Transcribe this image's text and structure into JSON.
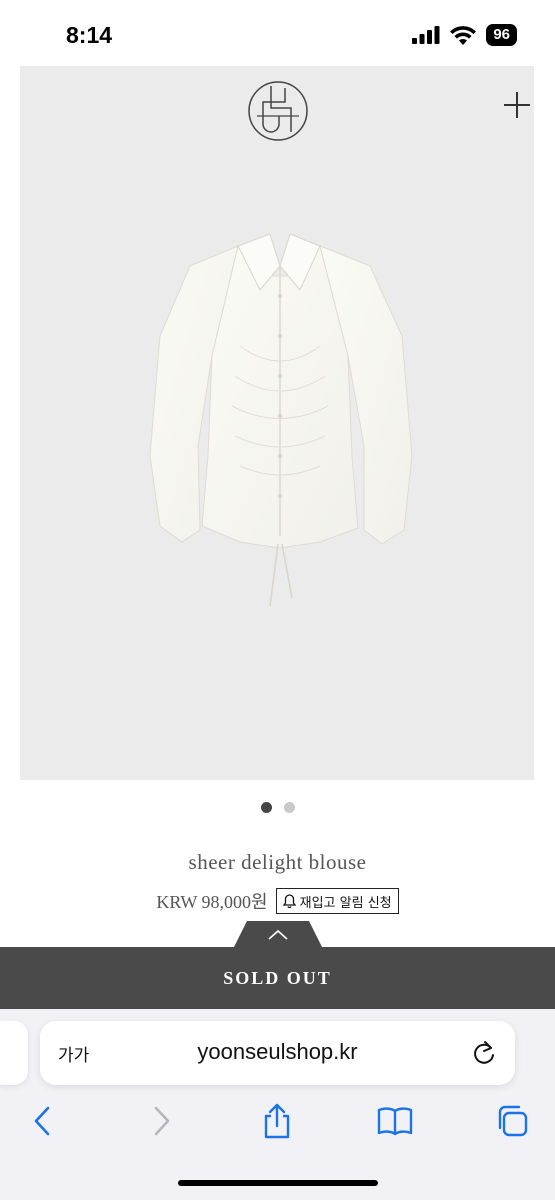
{
  "status_bar": {
    "time": "8:14",
    "battery": "96"
  },
  "product": {
    "name": "sheer delight blouse",
    "price": "KRW 98,000원",
    "restock_label": "재입고 알림 신청",
    "carousel": {
      "count": 2,
      "active": 1
    }
  },
  "purchase": {
    "sold_out_label": "SOLD OUT"
  },
  "browser": {
    "text_size_label": "가가",
    "url": "yoonseulshop.kr"
  },
  "colors": {
    "sold_out_bar": "#4a4a4a",
    "ios_blue": "#1a73e8",
    "image_background": "#ebebeb"
  },
  "icons": [
    "signal-icon",
    "wifi-icon",
    "logo-icon",
    "plus-icon",
    "bell-icon",
    "chevron-up-icon",
    "reload-icon",
    "back-icon",
    "forward-icon",
    "share-icon",
    "bookmarks-icon",
    "tabs-icon"
  ]
}
